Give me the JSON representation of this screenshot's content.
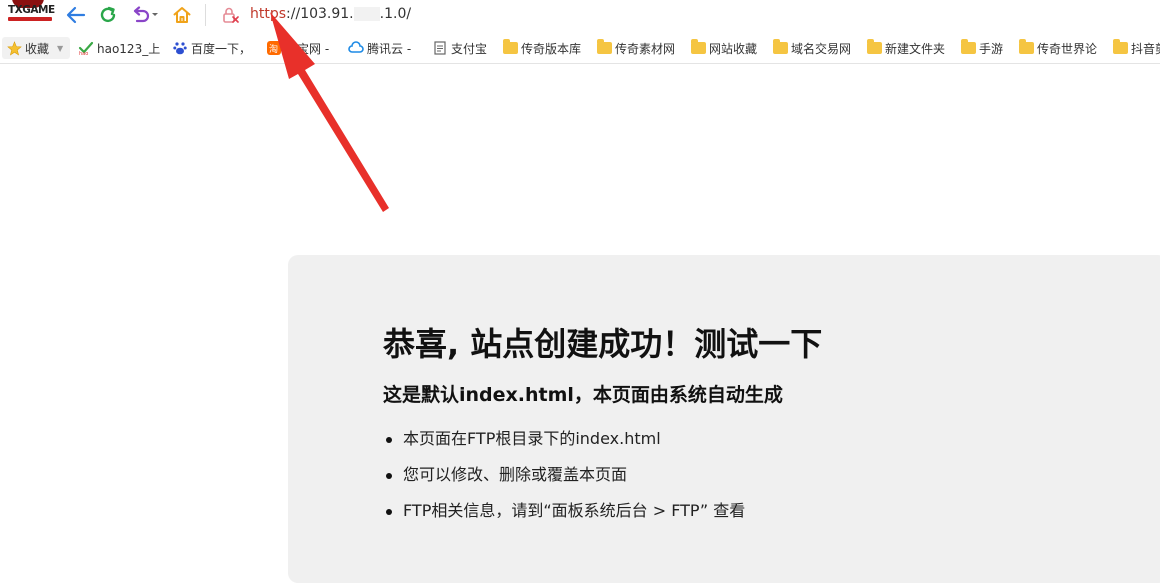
{
  "logo": {
    "text": "TXGAME"
  },
  "address_bar": {
    "scheme": "https",
    "rest_before": "://103.91.",
    "rest_after": ".1.0/"
  },
  "bookmarks": {
    "favorites_label": "收藏",
    "items": [
      {
        "label": "hao123_上",
        "icon": "hao123-icon"
      },
      {
        "label": "百度一下，",
        "icon": "baidu-icon"
      },
      {
        "label": "淘宝网 -",
        "icon": "taobao-icon"
      },
      {
        "label": "腾讯云 -",
        "icon": "cloud-icon"
      },
      {
        "label": "支付宝",
        "icon": "document-icon"
      },
      {
        "label": "传奇版本库",
        "icon": "folder-icon"
      },
      {
        "label": "传奇素材网",
        "icon": "folder-icon"
      },
      {
        "label": "网站收藏",
        "icon": "folder-icon"
      },
      {
        "label": "域名交易网",
        "icon": "folder-icon"
      },
      {
        "label": "新建文件夹",
        "icon": "folder-icon"
      },
      {
        "label": "手游",
        "icon": "folder-icon"
      },
      {
        "label": "传奇世界论",
        "icon": "folder-icon"
      },
      {
        "label": "抖音剪",
        "icon": "folder-icon"
      }
    ]
  },
  "content": {
    "title": "恭喜, 站点创建成功！测试一下",
    "subtitle": "这是默认index.html，本页面由系统自动生成",
    "bullets": [
      "本页面在FTP根目录下的index.html",
      "您可以修改、删除或覆盖本页面",
      "FTP相关信息，请到“面板系统后台 > FTP” 查看"
    ]
  },
  "colors": {
    "annotation_arrow": "#e8302a",
    "card_background": "#f0f0f0",
    "folder": "#f5c542"
  }
}
